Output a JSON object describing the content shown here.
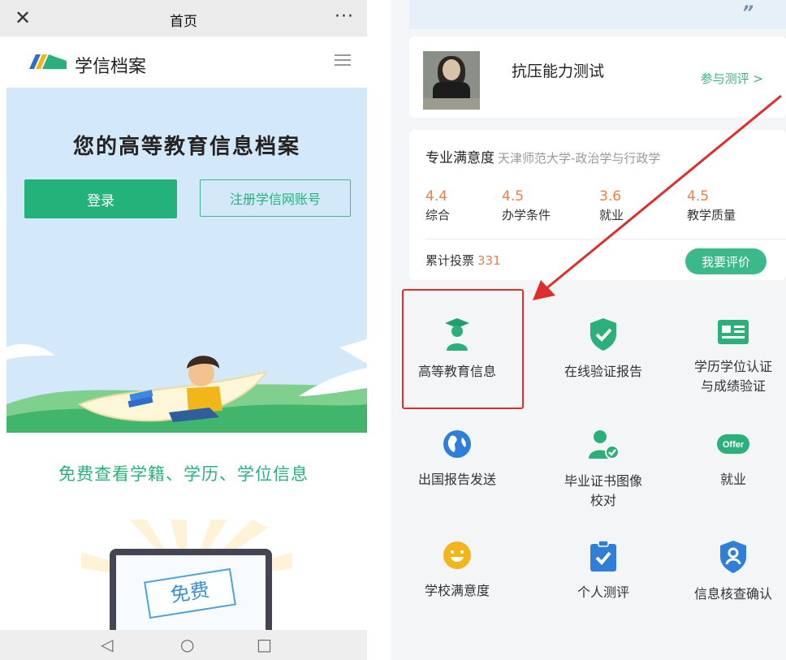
{
  "left": {
    "topbar": {
      "close_icon": "close-icon",
      "title": "首页",
      "more_icon": "more-dots-icon"
    },
    "brand": {
      "name": "学信档案",
      "logo_icon": "xuexin-logo-icon",
      "menu_icon": "hamburger-menu-icon"
    },
    "hero": {
      "headline": "您的高等教育信息档案",
      "login_label": "登录",
      "register_label": "注册学信网账号"
    },
    "slogan": "免费查看学籍、学历、学位信息",
    "promo": {
      "stamp_text": "免费"
    },
    "navbar": {
      "back_icon": "back-triangle-icon",
      "home_icon": "home-circle-icon",
      "recent_icon": "recent-square-icon"
    }
  },
  "right": {
    "test_card": {
      "title": "抗压能力测试",
      "action": "参与测评 >"
    },
    "satisfaction": {
      "title": "专业满意度",
      "school": "天津师范大学-政治学与行政学",
      "scores": [
        {
          "value": "4.4",
          "label": "综合"
        },
        {
          "value": "4.5",
          "label": "办学条件"
        },
        {
          "value": "3.6",
          "label": "就业"
        },
        {
          "value": "4.5",
          "label": "教学质量"
        }
      ],
      "votes_label": "累计投票",
      "votes_count": "331",
      "rate_label": "我要评价"
    },
    "grid": [
      {
        "label": "高等教育信息",
        "icon": "graduate-icon"
      },
      {
        "label": "在线验证报告",
        "icon": "shield-check-icon"
      },
      {
        "label": "学历学位认证\n与成绩验证",
        "icon": "id-card-icon"
      },
      {
        "label": "出国报告发送",
        "icon": "globe-icon"
      },
      {
        "label": "毕业证书图像\n校对",
        "icon": "person-check-icon"
      },
      {
        "label": "就业",
        "icon": "offer-icon"
      },
      {
        "label": "学校满意度",
        "icon": "smiley-icon"
      },
      {
        "label": "个人测评",
        "icon": "clipboard-check-icon"
      },
      {
        "label": "信息核查确认",
        "icon": "shield-user-icon"
      }
    ],
    "offer_badge": "Offer",
    "colors": {
      "accent": "#24b27a",
      "score": "#e8804a",
      "highlight": "#dd2d2d",
      "icon_blue": "#2f7fd8"
    }
  }
}
